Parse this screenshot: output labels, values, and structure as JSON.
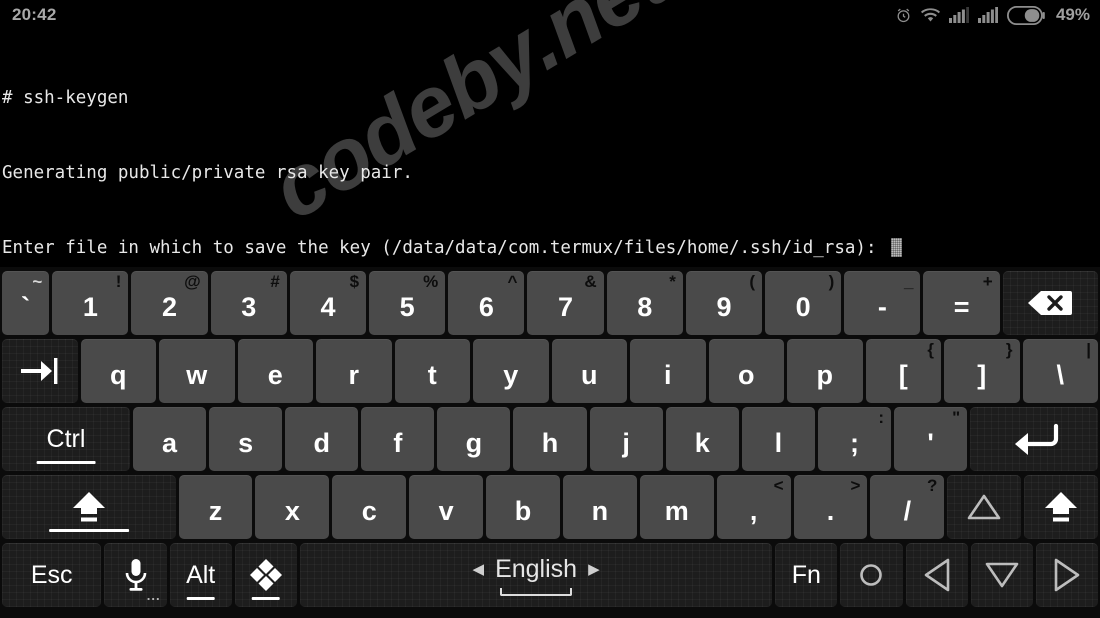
{
  "statusbar": {
    "clock": "20:42",
    "battery_percent": "49%",
    "icons": [
      "alarm-icon",
      "wifi-icon",
      "signal-sim1-icon",
      "signal-sim2-icon",
      "battery-icon"
    ]
  },
  "terminal": {
    "lines": [
      "# ssh-keygen",
      "Generating public/private rsa key pair.",
      "Enter file in which to save the key (/data/data/com.termux/files/home/.ssh/id_rsa): "
    ],
    "prompt_symbol": "#",
    "command": "ssh-keygen",
    "key_path": "/data/data/com.termux/files/home/.ssh/id_rsa",
    "cursor": "block-cursor"
  },
  "watermark": {
    "text": "codeby.net"
  },
  "keyboard": {
    "language": "English",
    "language_prev_arrow": "◀",
    "language_next_arrow": "▶",
    "rows": [
      {
        "name": "number-row",
        "keys": [
          {
            "name": "key-backtick",
            "main": "`",
            "sup": "~",
            "sup_style": "light",
            "style": "light",
            "flex": 0.62
          },
          {
            "name": "key-1",
            "main": "1",
            "sup": "!",
            "style": "light"
          },
          {
            "name": "key-2",
            "main": "2",
            "sup": "@",
            "style": "light"
          },
          {
            "name": "key-3",
            "main": "3",
            "sup": "#",
            "style": "light"
          },
          {
            "name": "key-4",
            "main": "4",
            "sup": "$",
            "style": "light"
          },
          {
            "name": "key-5",
            "main": "5",
            "sup": "%",
            "style": "light"
          },
          {
            "name": "key-6",
            "main": "6",
            "sup": "^",
            "style": "light"
          },
          {
            "name": "key-7",
            "main": "7",
            "sup": "&",
            "style": "light"
          },
          {
            "name": "key-8",
            "main": "8",
            "sup": "*",
            "style": "light"
          },
          {
            "name": "key-9",
            "main": "9",
            "sup": "(",
            "style": "light"
          },
          {
            "name": "key-0",
            "main": "0",
            "sup": ")",
            "style": "light"
          },
          {
            "name": "key-minus",
            "main": "-",
            "sup": "_",
            "style": "light"
          },
          {
            "name": "key-equals",
            "main": "=",
            "sup": "+",
            "style": "light"
          },
          {
            "name": "key-backspace",
            "icon": "backspace-icon",
            "style": "dark",
            "flex": 1.25
          }
        ]
      },
      {
        "name": "qwerty-row",
        "keys": [
          {
            "name": "key-tab",
            "icon": "tab-icon",
            "style": "dark",
            "flex": 1.0
          },
          {
            "name": "key-q",
            "main": "q",
            "style": "light"
          },
          {
            "name": "key-w",
            "main": "w",
            "style": "light"
          },
          {
            "name": "key-e",
            "main": "e",
            "style": "light"
          },
          {
            "name": "key-r",
            "main": "r",
            "style": "light"
          },
          {
            "name": "key-t",
            "main": "t",
            "style": "light"
          },
          {
            "name": "key-y",
            "main": "y",
            "style": "light"
          },
          {
            "name": "key-u",
            "main": "u",
            "style": "light"
          },
          {
            "name": "key-i",
            "main": "i",
            "style": "light"
          },
          {
            "name": "key-o",
            "main": "o",
            "style": "light"
          },
          {
            "name": "key-p",
            "main": "p",
            "style": "light"
          },
          {
            "name": "key-bracket-left",
            "main": "[",
            "sup": "{",
            "style": "light"
          },
          {
            "name": "key-bracket-right",
            "main": "]",
            "sup": "}",
            "style": "light"
          },
          {
            "name": "key-backslash",
            "main": "\\",
            "sup": "|",
            "style": "light"
          }
        ]
      },
      {
        "name": "home-row",
        "keys": [
          {
            "name": "key-ctrl",
            "label": "Ctrl",
            "style": "dark",
            "underline": true,
            "flex": 1.75
          },
          {
            "name": "key-a",
            "main": "a",
            "style": "light"
          },
          {
            "name": "key-s",
            "main": "s",
            "style": "light"
          },
          {
            "name": "key-d",
            "main": "d",
            "style": "light"
          },
          {
            "name": "key-f",
            "main": "f",
            "style": "light"
          },
          {
            "name": "key-g",
            "main": "g",
            "style": "light"
          },
          {
            "name": "key-h",
            "main": "h",
            "style": "light"
          },
          {
            "name": "key-j",
            "main": "j",
            "style": "light"
          },
          {
            "name": "key-k",
            "main": "k",
            "style": "light"
          },
          {
            "name": "key-l",
            "main": "l",
            "style": "light"
          },
          {
            "name": "key-semicolon",
            "main": ";",
            "sup": ":",
            "style": "light"
          },
          {
            "name": "key-quote",
            "main": "'",
            "sup": "\"",
            "style": "light"
          },
          {
            "name": "key-enter",
            "icon": "enter-icon",
            "style": "dark",
            "flex": 1.75
          }
        ]
      },
      {
        "name": "zxcv-row",
        "keys": [
          {
            "name": "key-shift-left",
            "icon": "shift-icon",
            "style": "dark",
            "underline": true,
            "flex": 2.35
          },
          {
            "name": "key-z",
            "main": "z",
            "style": "light"
          },
          {
            "name": "key-x",
            "main": "x",
            "style": "light"
          },
          {
            "name": "key-c",
            "main": "c",
            "style": "light"
          },
          {
            "name": "key-v",
            "main": "v",
            "style": "light"
          },
          {
            "name": "key-b",
            "main": "b",
            "style": "light"
          },
          {
            "name": "key-n",
            "main": "n",
            "style": "light"
          },
          {
            "name": "key-m",
            "main": "m",
            "style": "light"
          },
          {
            "name": "key-comma",
            "main": ",",
            "sup": "<",
            "style": "light"
          },
          {
            "name": "key-period",
            "main": ".",
            "sup": ">",
            "style": "light"
          },
          {
            "name": "key-slash",
            "main": "/",
            "sup": "?",
            "style": "light"
          },
          {
            "name": "key-arrow-up",
            "icon": "arrow-up-icon",
            "style": "dark"
          },
          {
            "name": "key-shift-right",
            "icon": "shift-icon",
            "style": "dark"
          }
        ]
      },
      {
        "name": "function-row",
        "keys": [
          {
            "name": "key-esc",
            "label": "Esc",
            "style": "dark",
            "flex": 1.6
          },
          {
            "name": "key-voice-input",
            "icon": "microphone-icon",
            "style": "dark",
            "dots": "...",
            "flex": 1.0
          },
          {
            "name": "key-alt",
            "label": "Alt",
            "style": "dark",
            "underline": true,
            "flex": 1.0
          },
          {
            "name": "key-symbols",
            "icon": "diamond-grid-icon",
            "style": "dark",
            "underline": true,
            "flex": 1.0
          },
          {
            "name": "key-space",
            "style": "dark",
            "spacebar": true
          },
          {
            "name": "key-fn",
            "label": "Fn",
            "style": "dark",
            "flex": 1.0
          },
          {
            "name": "key-circle",
            "icon": "circle-icon",
            "style": "dark",
            "flex": 1.0
          },
          {
            "name": "key-arrow-left",
            "icon": "arrow-left-icon",
            "style": "dark",
            "flex": 1.0
          },
          {
            "name": "key-arrow-down",
            "icon": "arrow-down-icon",
            "style": "dark",
            "flex": 1.0
          },
          {
            "name": "key-arrow-right",
            "icon": "arrow-right-icon",
            "style": "dark",
            "flex": 1.0
          }
        ]
      }
    ]
  },
  "colors": {
    "background": "#000000",
    "key_light": "#4a4a4a",
    "key_dark": "#1d1d1d",
    "text": "#ffffff",
    "terminal_text": "#e8e8e8",
    "status_text": "#9a9a9a"
  }
}
